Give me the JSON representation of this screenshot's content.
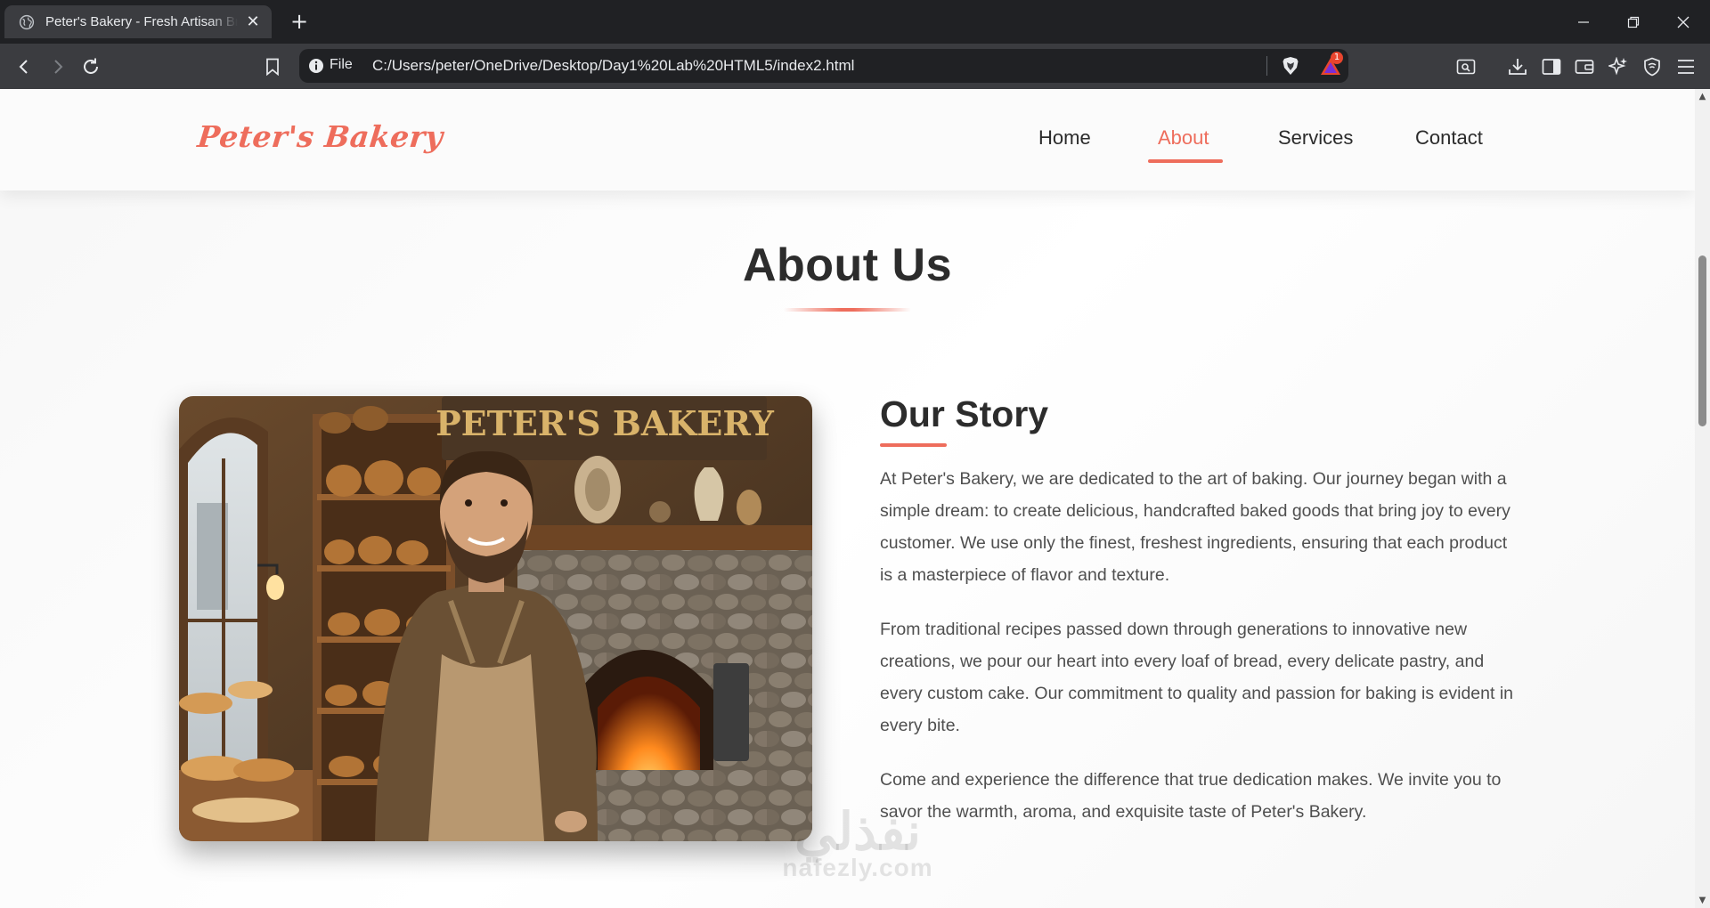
{
  "browser": {
    "tab": {
      "title": "Peter's Bakery - Fresh Artisan Bre",
      "icon": "globe-icon"
    },
    "address": {
      "scheme_label": "File",
      "url": "C:/Users/peter/OneDrive/Desktop/Day1%20Lab%20HTML5/index2.html"
    },
    "rewards_badge": "1",
    "colors": {
      "chrome_dark": "#202124",
      "chrome_toolbar": "#3b3c40",
      "text": "#e8eaed"
    }
  },
  "site": {
    "logo": "Peter's Bakery",
    "nav": [
      {
        "label": "Home",
        "active": false
      },
      {
        "label": "About",
        "active": true
      },
      {
        "label": "Services",
        "active": false
      },
      {
        "label": "Contact",
        "active": false
      }
    ],
    "about": {
      "title": "About Us",
      "story_title": "Our Story",
      "paragraphs": [
        "At Peter's Bakery, we are dedicated to the art of baking. Our journey began with a simple dream: to create delicious, handcrafted baked goods that bring joy to every customer. We use only the finest, freshest ingredients, ensuring that each product is a masterpiece of flavor and texture.",
        "From traditional recipes passed down through generations to innovative new creations, we pour our heart into every loaf of bread, every delicate pastry, and every custom cake. Our commitment to quality and passion for baking is evident in every bite.",
        "Come and experience the difference that true dedication makes. We invite you to savor the warmth, aroma, and exquisite taste of Peter's Bakery."
      ]
    },
    "photo": {
      "sign_text": "PETER'S BAKERY"
    },
    "watermark": {
      "arabic": "نفذلي",
      "latin": "nafezly.com"
    },
    "colors": {
      "accent": "#ee6d5c",
      "heading": "#2c2c2c",
      "body_text": "#4f4f4f"
    }
  }
}
